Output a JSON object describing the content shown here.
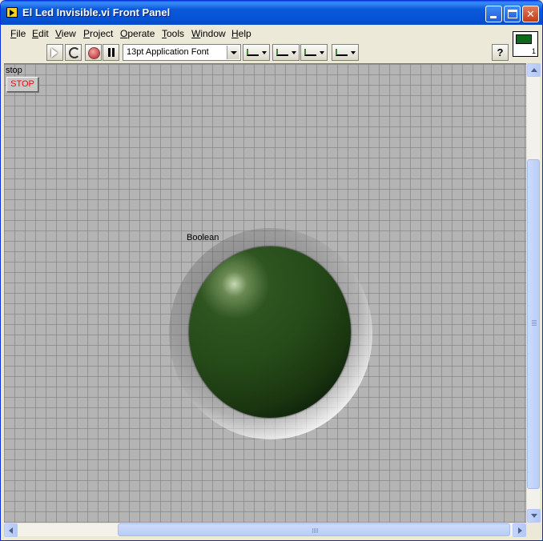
{
  "window": {
    "title": "El Led Invisible.vi Front Panel"
  },
  "menu": {
    "items": [
      "File",
      "Edit",
      "View",
      "Project",
      "Operate",
      "Tools",
      "Window",
      "Help"
    ]
  },
  "toolbar": {
    "font_select_value": "13pt Application Font",
    "help_label": "?"
  },
  "vi_icon": {
    "number": "1"
  },
  "panel": {
    "stop_label": "stop",
    "stop_button_text": "STOP",
    "boolean_label": "Boolean",
    "led_state": "off",
    "led_color": "#254b18",
    "panel_background": "#b4b4b4"
  },
  "colors": {
    "titlebar": "#0653d6",
    "stop_text": "#e01010"
  }
}
